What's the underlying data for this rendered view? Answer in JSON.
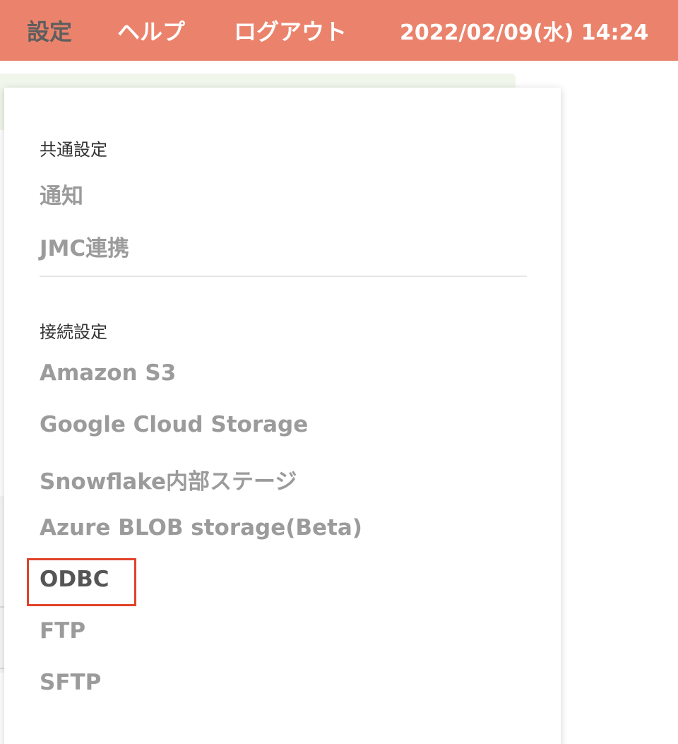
{
  "header": {
    "settings_label": "設定",
    "help_label": "ヘルプ",
    "logout_label": "ログアウト",
    "datetime": "2022/02/09(水) 14:24"
  },
  "dropdown": {
    "common_section": {
      "title": "共通設定",
      "items": [
        "通知",
        "JMC連携"
      ]
    },
    "connection_section": {
      "title": "接続設定",
      "items": [
        "Amazon S3",
        "Google Cloud Storage",
        "Snowflake内部ステージ",
        "Azure BLOB storage(Beta)",
        "ODBC",
        "FTP",
        "SFTP"
      ]
    }
  },
  "colors": {
    "topbar": "#eb836c",
    "highlight_border": "#e0422b",
    "inactive_item": "#9b9b9b",
    "active_item": "#555555"
  }
}
